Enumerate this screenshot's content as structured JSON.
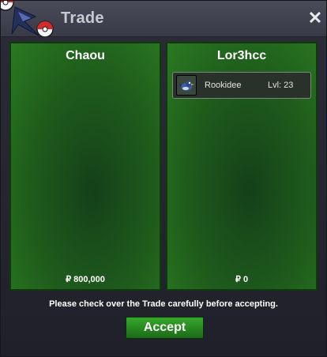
{
  "window": {
    "title": "Trade",
    "close_glyph": "✕"
  },
  "left_panel": {
    "name": "Chaou",
    "money": "₽ 800,000",
    "items": []
  },
  "right_panel": {
    "name": "Lor3hcc",
    "money": "₽ 0",
    "items": [
      {
        "name": "Rookidee",
        "level": "Lvl: 23",
        "icon": "rookidee-icon"
      }
    ]
  },
  "notice": "Please check over the Trade carefully before accepting.",
  "accept_label": "Accept",
  "colors": {
    "panel_green": "#2a7a22",
    "accept_green": "#37a82d",
    "titlebar": "#4a4b59"
  }
}
